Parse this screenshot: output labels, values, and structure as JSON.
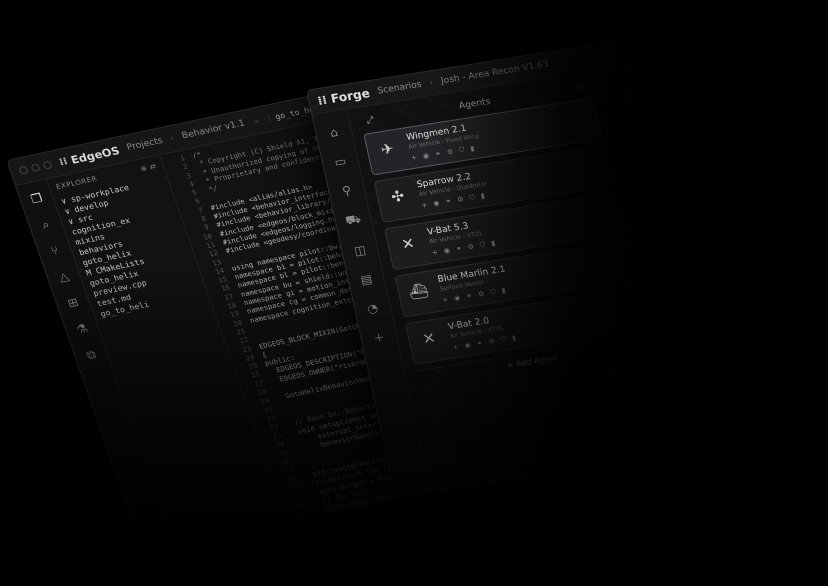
{
  "edgeos": {
    "brand": "EdgeOS",
    "breadcrumb": [
      "Projects",
      "Behavior v1.1"
    ],
    "tab": "go_to_helix_be...",
    "explorer": {
      "title": "EXPLORER",
      "items": [
        "∨ sp-workplace",
        "  ∨ develop",
        "    ∨ src",
        "    cognition_ex",
        "    mixins",
        "    behaviors",
        "    goto_helix",
        "    M CMakeLists",
        "    goto_helix",
        "    preview.cpp",
        "    test.md",
        "    go_to_heli"
      ]
    },
    "line_numbers": [
      "1",
      "2",
      "3",
      "4",
      "5",
      "6",
      "7",
      "8",
      "9",
      "10",
      "11",
      "12",
      "13",
      "14",
      "15",
      "16",
      "17",
      "18",
      "19",
      "20",
      "21",
      "22",
      "23",
      "24",
      "25",
      "26",
      "27",
      "28",
      "29",
      "30",
      "31",
      "32",
      "33",
      "34",
      "35",
      "36",
      "37",
      "38",
      "39",
      "40",
      "41",
      "42"
    ],
    "code_lines": [
      "/*",
      " * Copyright (C) Shield AI, Inc",
      " * Unauthorized copying of this",
      " * Proprietary and confidential",
      " */",
      "",
      "#include <alias/alias.h>",
      "#include <behavior_interface/be",
      "#include <behavior_library/beh",
      "#include <edgeos/block_mixin.h>",
      "#include <edgeos/logging.h>",
      "#include <geodesy/coordinate_s",
      "",
      "using namespace pilot::bw;",
      "namespace bi = pilot::behavior",
      "namespace bl = pilot::behavior",
      "namespace bu = shield::units;",
      "namespace gi = motion_interfac",
      "namespace cg = common_data_type",
      "namespace cognition_extension",
      "",
      "",
      "EDGEOS_BLOCK_MIXIN(GotoHelix",
      "{",
      "public:",
      "  EDGEOS_DESCRIPTION(\"Goto He",
      "  EDGEOS_OWNER(\"rivera@shd",
      "",
      "  GotoHelixBehaviorHandler(G",
      "",
      "",
      "  // Base be::BehaviorHandle",
      "  void setup(const behavior_i",
      "      external_interfa",
      "      BehaviorHandlerBa",
      "",
      "",
      "  std::vector<motion_interf",
      "  // Retrieve the target",
      "  auto target = msg.get",
      "  // The helix will start",
      "  pilot_msgs::Helix"
    ]
  },
  "forge": {
    "brand": "Forge",
    "breadcrumb": [
      "Scenarios",
      "Josh - Area Recon V1.63"
    ],
    "panel_title": "Agents",
    "agents": [
      {
        "name": "Wingmen 2.1",
        "sub": "Air Vehicle - Fixed Wing",
        "icon": "✈",
        "selected": true
      },
      {
        "name": "Sparrow 2.2",
        "sub": "Air Vehicle - Quadrotor",
        "icon": "✣",
        "selected": false
      },
      {
        "name": "V-Bat 5.3",
        "sub": "Air Vehicle - VTOL",
        "icon": "✕",
        "selected": false
      },
      {
        "name": "Blue Marlin 2.1",
        "sub": "Surface Vessel",
        "icon": "⛴",
        "selected": false
      },
      {
        "name": "V-Bat 2.0",
        "sub": "Air Vehicle - VTOL",
        "icon": "✕",
        "selected": false
      }
    ],
    "add_agent_label": "+ Add Agent"
  }
}
